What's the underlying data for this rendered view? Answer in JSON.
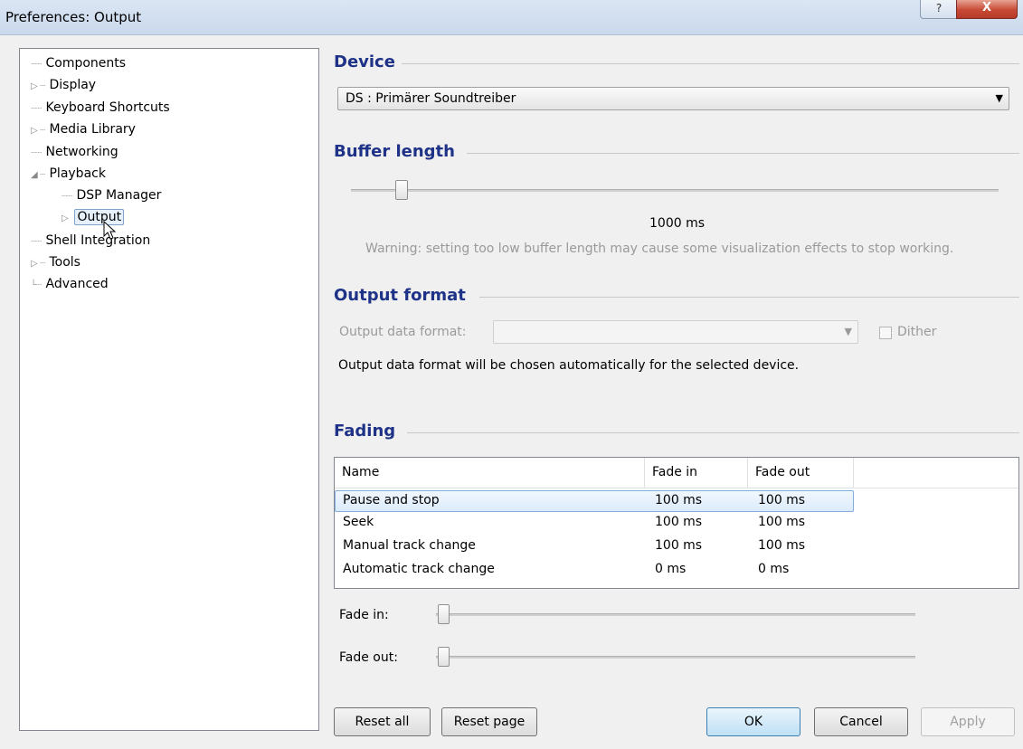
{
  "window": {
    "title": "Preferences: Output",
    "help_label": "?",
    "close_label": "X"
  },
  "tree": {
    "items": [
      {
        "label": "Components",
        "expander": ""
      },
      {
        "label": "Display",
        "expander": "▷"
      },
      {
        "label": "Keyboard Shortcuts",
        "expander": ""
      },
      {
        "label": "Media Library",
        "expander": "▷"
      },
      {
        "label": "Networking",
        "expander": ""
      },
      {
        "label": "Playback",
        "expander": "◢"
      },
      {
        "label": "DSP Manager",
        "expander": ""
      },
      {
        "label": "Output",
        "expander": "▷"
      },
      {
        "label": "Shell Integration",
        "expander": ""
      },
      {
        "label": "Tools",
        "expander": "▷"
      },
      {
        "label": "Advanced",
        "expander": ""
      }
    ],
    "selected": "Output"
  },
  "device": {
    "title": "Device",
    "value": "DS : Primärer Soundtreiber"
  },
  "buffer": {
    "title": "Buffer length",
    "value": "1000 ms",
    "level": 0.05,
    "warning": "Warning: setting too low buffer length may cause some visualization effects to stop working."
  },
  "output_format": {
    "title": "Output format",
    "data_format_label": "Output data format:",
    "data_format_value": "",
    "dither_label": "Dither",
    "dither_checked": false,
    "note": "Output data format will be chosen automatically for the selected device."
  },
  "fading": {
    "title": "Fading",
    "columns": [
      "Name",
      "Fade in",
      "Fade out"
    ],
    "rows": [
      {
        "name": "Pause and stop",
        "fade_in": "100 ms",
        "fade_out": "100 ms"
      },
      {
        "name": "Seek",
        "fade_in": "100 ms",
        "fade_out": "100 ms"
      },
      {
        "name": "Manual track change",
        "fade_in": "100 ms",
        "fade_out": "100 ms"
      },
      {
        "name": "Automatic track change",
        "fade_in": "0 ms",
        "fade_out": "0 ms"
      }
    ],
    "selected_row": 0,
    "fade_in_label": "Fade in:",
    "fade_out_label": "Fade out:",
    "fade_in_level": 0.0,
    "fade_out_level": 0.0
  },
  "buttons": {
    "reset_all": "Reset all",
    "reset_page": "Reset page",
    "ok": "OK",
    "cancel": "Cancel",
    "apply": "Apply"
  }
}
